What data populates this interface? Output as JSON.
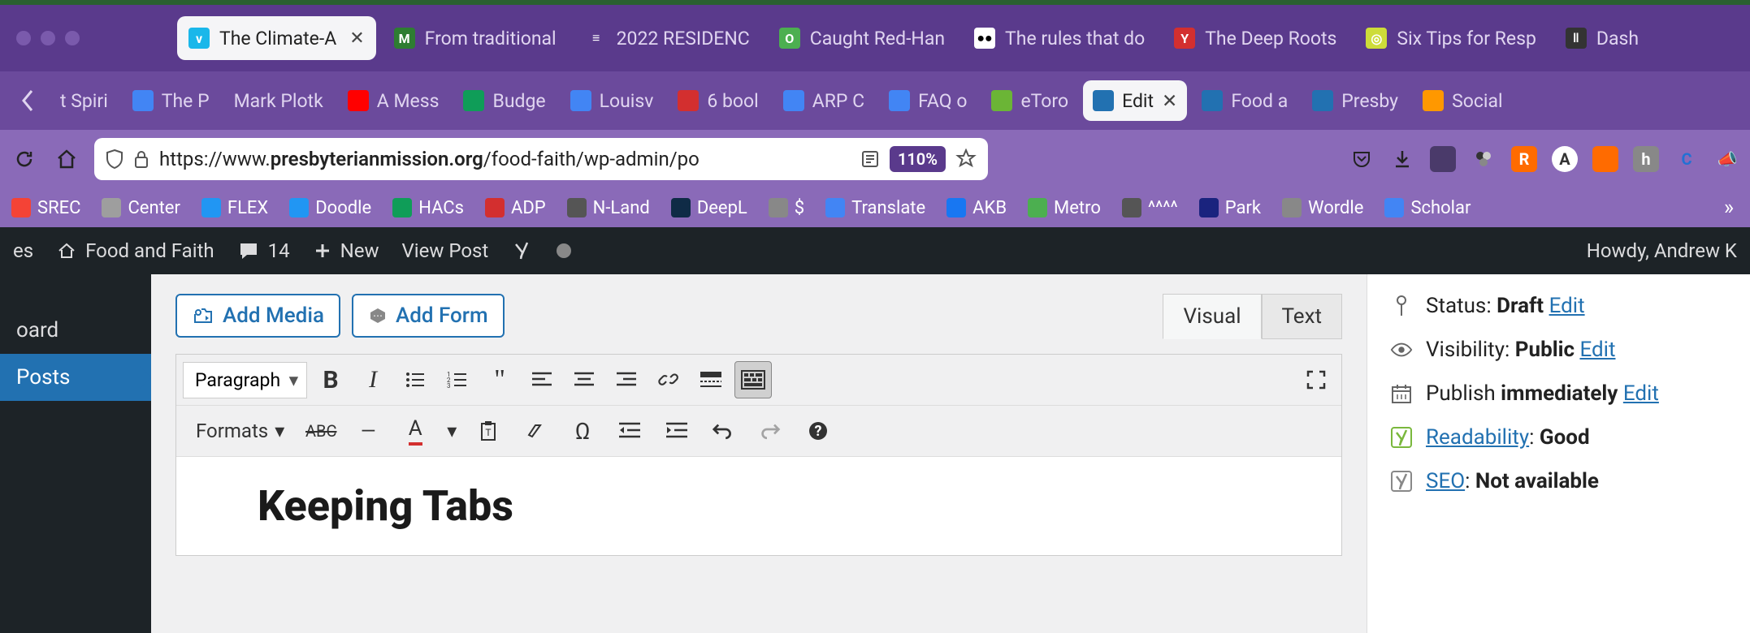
{
  "window": {
    "tabs_row1": [
      {
        "label": "The Climate-A",
        "favicon_bg": "#1ab7ea",
        "favicon_text": "v",
        "active": true
      },
      {
        "label": "From traditional",
        "favicon_bg": "#2e7d32",
        "favicon_text": "M"
      },
      {
        "label": "2022 RESIDENC",
        "favicon_bg": "#5a3a8c",
        "favicon_text": "≡"
      },
      {
        "label": "Caught Red-Han",
        "favicon_bg": "#4caf50",
        "favicon_text": "O"
      },
      {
        "label": "The rules that do",
        "favicon_bg": "#fff",
        "favicon_text": "●●"
      },
      {
        "label": "The Deep Roots",
        "favicon_bg": "#d32f2f",
        "favicon_text": "Y"
      },
      {
        "label": "Six Tips for Resp",
        "favicon_bg": "#cddc39",
        "favicon_text": "◎"
      },
      {
        "label": "Dash",
        "favicon_bg": "#333",
        "favicon_text": "‖"
      }
    ],
    "tabs_row2": [
      {
        "label": "t Spiri"
      },
      {
        "label": "The P",
        "favicon_bg": "#4285f4"
      },
      {
        "label": "Mark Plotk"
      },
      {
        "label": "A Mess",
        "favicon_bg": "#ff0000"
      },
      {
        "label": "Budge",
        "favicon_bg": "#0f9d58"
      },
      {
        "label": "Louisv",
        "favicon_bg": "#4285f4"
      },
      {
        "label": "6 bool",
        "favicon_bg": "#d32f2f"
      },
      {
        "label": "ARP C",
        "favicon_bg": "#4285f4"
      },
      {
        "label": "FAQ o",
        "favicon_bg": "#4285f4"
      },
      {
        "label": "eToro",
        "favicon_bg": "#6bb536"
      },
      {
        "label": "Edit",
        "favicon_bg": "#2271b1",
        "active": true
      },
      {
        "label": "Food a",
        "favicon_bg": "#2271b1"
      },
      {
        "label": "Presby",
        "favicon_bg": "#2271b1"
      },
      {
        "label": "Social",
        "favicon_bg": "#ff9800"
      }
    ]
  },
  "url_bar": {
    "host": "presbyterianmission.org",
    "prefix": "https://www.",
    "suffix": "/food-faith/wp-admin/po",
    "zoom": "110%"
  },
  "bookmarks": [
    {
      "label": "SREC",
      "color": "#f44336"
    },
    {
      "label": "Center",
      "color": "#9e9e9e"
    },
    {
      "label": "FLEX",
      "color": "#2196f3"
    },
    {
      "label": "Doodle",
      "color": "#2196f3"
    },
    {
      "label": "HACs",
      "color": "#0f9d58"
    },
    {
      "label": "ADP",
      "color": "#d32f2f"
    },
    {
      "label": "N-Land",
      "color": "#555"
    },
    {
      "label": "DeepL",
      "color": "#0f2b46"
    },
    {
      "label": "$",
      "color": "#888"
    },
    {
      "label": "Translate",
      "color": "#4285f4"
    },
    {
      "label": "AKB",
      "color": "#1877f2"
    },
    {
      "label": "Metro",
      "color": "#4caf50"
    },
    {
      "label": "^^^^",
      "color": "#555"
    },
    {
      "label": "Park",
      "color": "#1a237e"
    },
    {
      "label": "Wordle",
      "color": "#888"
    },
    {
      "label": "Scholar",
      "color": "#4285f4"
    }
  ],
  "wp_admin_bar": {
    "my_sites": "es",
    "site_name": "Food and Faith",
    "comments": "14",
    "new": "New",
    "view_post": "View Post",
    "howdy": "Howdy, Andrew K"
  },
  "wp_sidebar": {
    "items": [
      "oard",
      "Posts"
    ]
  },
  "editor": {
    "add_media": "Add Media",
    "add_form": "Add Form",
    "visual_tab": "Visual",
    "text_tab": "Text",
    "paragraph": "Paragraph",
    "formats": "Formats",
    "content_title": "Keeping Tabs"
  },
  "publish": {
    "status_label": "Status: ",
    "status_value": "Draft",
    "visibility_label": "Visibility: ",
    "visibility_value": "Public",
    "publish_label": "Publish ",
    "publish_value": "immediately",
    "readability_label": "Readability",
    "readability_value": "Good",
    "seo_label": "SEO",
    "seo_value": "Not available",
    "edit": "Edit"
  }
}
